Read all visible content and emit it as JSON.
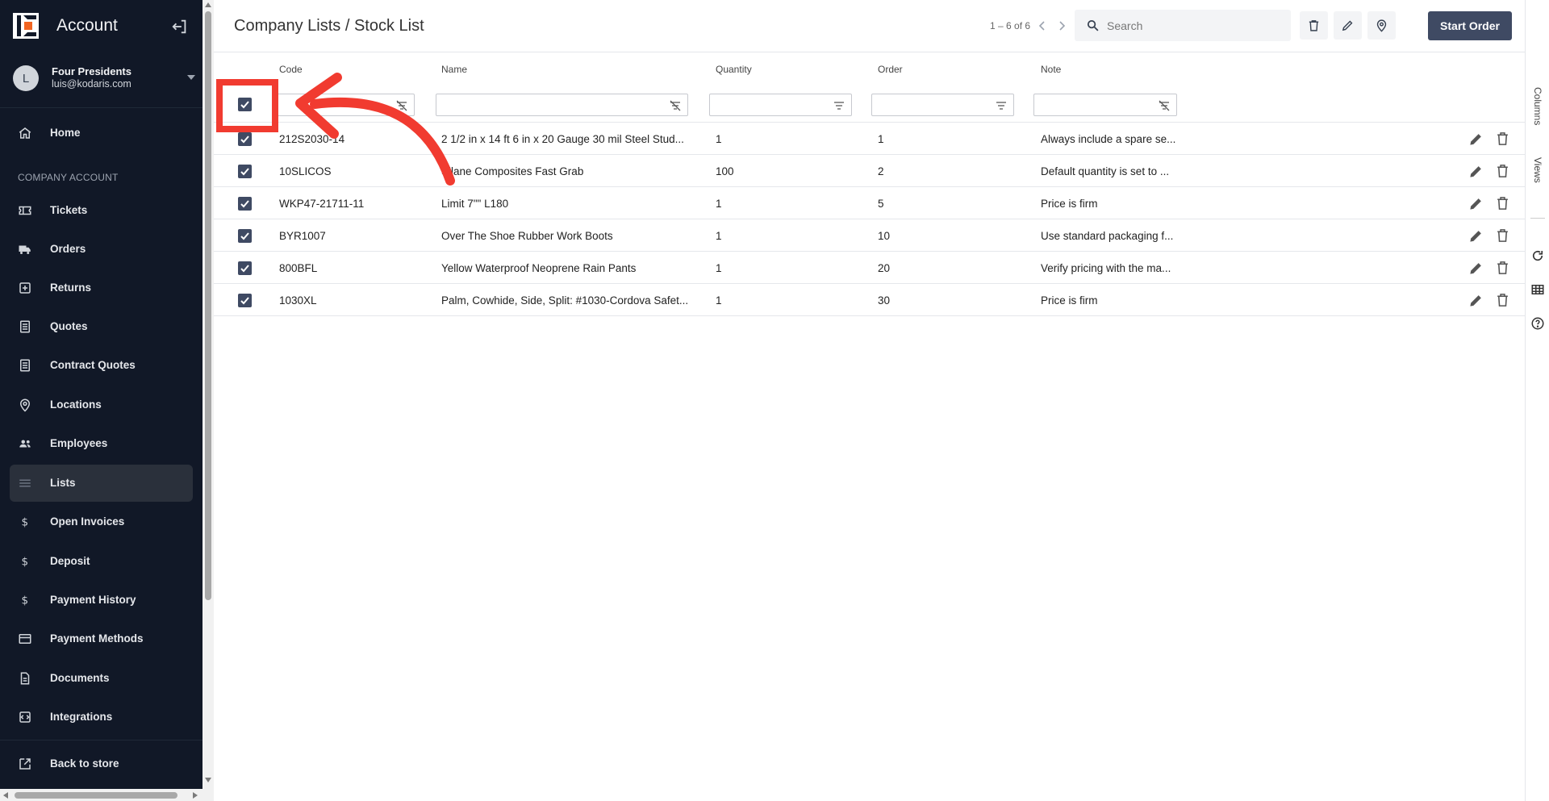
{
  "sidebar": {
    "title": "Account",
    "user": {
      "initial": "L",
      "name": "Four Presidents",
      "email": "luis@kodaris.com"
    },
    "section_label": "COMPANY ACCOUNT",
    "items": [
      {
        "label": "Home",
        "icon": "home-icon"
      },
      {
        "label": "Tickets",
        "icon": "ticket-icon"
      },
      {
        "label": "Orders",
        "icon": "truck-icon"
      },
      {
        "label": "Returns",
        "icon": "returns-icon"
      },
      {
        "label": "Quotes",
        "icon": "quote-icon"
      },
      {
        "label": "Contract Quotes",
        "icon": "contract-quote-icon"
      },
      {
        "label": "Locations",
        "icon": "location-pin-icon"
      },
      {
        "label": "Employees",
        "icon": "people-icon"
      },
      {
        "label": "Lists",
        "icon": "list-icon",
        "active": true
      },
      {
        "label": "Open Invoices",
        "icon": "dollar-icon"
      },
      {
        "label": "Deposit",
        "icon": "dollar-icon"
      },
      {
        "label": "Payment History",
        "icon": "dollar-icon"
      },
      {
        "label": "Payment Methods",
        "icon": "credit-card-icon"
      },
      {
        "label": "Documents",
        "icon": "document-icon"
      },
      {
        "label": "Integrations",
        "icon": "integration-icon"
      }
    ],
    "back_label": "Back to store"
  },
  "header": {
    "title": "Company Lists / Stock List",
    "pager": "1 – 6 of 6",
    "search_placeholder": "Search",
    "start_order_label": "Start Order"
  },
  "table": {
    "columns": [
      "Code",
      "Name",
      "Quantity",
      "Order",
      "Note"
    ],
    "rows": [
      {
        "code": "212S2030-14",
        "name": "2 1/2 in x 14 ft 6 in x 20 Gauge 30 mil Steel Stud...",
        "quantity": "1",
        "order": "1",
        "note": "Always include a spare se..."
      },
      {
        "code": "10SLICOS",
        "name": "Silane Composites Fast Grab",
        "quantity": "100",
        "order": "2",
        "note": "Default quantity is set to ..."
      },
      {
        "code": "WKP47-21711-11",
        "name": "Limit 7\"\" L180",
        "quantity": "1",
        "order": "5",
        "note": "Price is firm"
      },
      {
        "code": "BYR1007",
        "name": "Over The Shoe Rubber Work Boots",
        "quantity": "1",
        "order": "10",
        "note": "Use standard packaging f..."
      },
      {
        "code": "800BFL",
        "name": "Yellow Waterproof Neoprene Rain Pants",
        "quantity": "1",
        "order": "20",
        "note": "Verify pricing with the ma..."
      },
      {
        "code": "1030XL",
        "name": "Palm, Cowhide, Side, Split: #1030-Cordova Safet...",
        "quantity": "1",
        "order": "30",
        "note": "Price is firm"
      }
    ]
  },
  "rail": {
    "columns_label": "Columns",
    "views_label": "Views"
  },
  "colors": {
    "sidebar_bg": "#111827",
    "primary": "#3f4a63",
    "annotation": "#f13b30"
  }
}
